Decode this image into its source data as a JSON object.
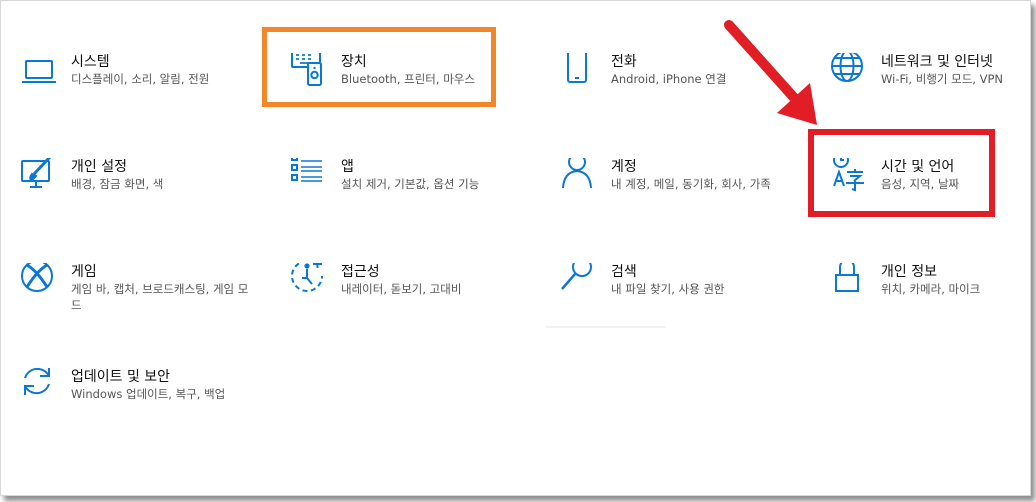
{
  "colors": {
    "icon": "#0a78d4",
    "highlight_orange": "#f4862a",
    "highlight_red": "#e11d25",
    "arrow_red": "#e11d25"
  },
  "tiles": [
    {
      "title": "시스템",
      "desc": "디스플레이, 소리, 알림, 전원",
      "icon": "laptop-icon"
    },
    {
      "title": "장치",
      "desc": "Bluetooth, 프린터, 마우스",
      "icon": "devices-icon"
    },
    {
      "title": "전화",
      "desc": "Android, iPhone 연결",
      "icon": "phone-icon"
    },
    {
      "title": "네트워크 및 인터넷",
      "desc": "Wi-Fi, 비행기 모드, VPN",
      "icon": "globe-icon"
    },
    {
      "title": "개인 설정",
      "desc": "배경, 잠금 화면, 색",
      "icon": "personalization-icon"
    },
    {
      "title": "앱",
      "desc": "설치 제거, 기본값, 옵션 기능",
      "icon": "apps-list-icon"
    },
    {
      "title": "계정",
      "desc": "내 계정, 메일, 동기화, 회사, 가족",
      "icon": "person-icon"
    },
    {
      "title": "시간 및 언어",
      "desc": "음성, 지역, 날짜",
      "icon": "time-language-icon"
    },
    {
      "title": "게임",
      "desc": "게임 바, 캡처, 브로드캐스팅, 게임 모드",
      "icon": "xbox-icon"
    },
    {
      "title": "접근성",
      "desc": "내레이터, 돋보기, 고대비",
      "icon": "ease-of-access-icon"
    },
    {
      "title": "검색",
      "desc": "내 파일 찾기, 사용 권한",
      "icon": "search-icon"
    },
    {
      "title": "개인 정보",
      "desc": "위치, 카메라, 마이크",
      "icon": "lock-icon"
    },
    {
      "title": "업데이트 및 보안",
      "desc": "Windows 업데이트, 복구, 백업",
      "icon": "sync-icon"
    }
  ]
}
